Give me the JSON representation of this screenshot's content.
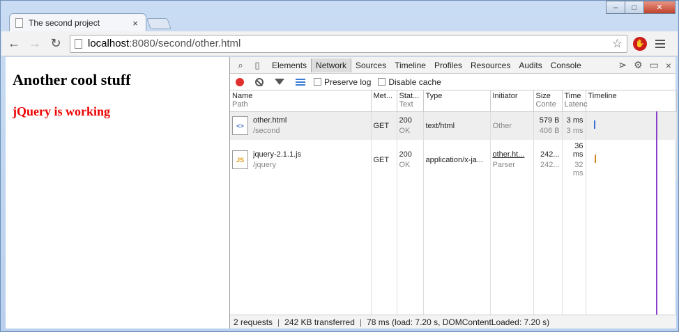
{
  "window": {
    "tab_title": "The second project",
    "tab_close": "×",
    "controls": {
      "minimize": "–",
      "maximize": "□",
      "close": "✕"
    }
  },
  "toolbar": {
    "url_host": "localhost",
    "url_path": ":8080/second/other.html",
    "back": "←",
    "forward": "→",
    "reload": "↻",
    "star": "☆"
  },
  "page": {
    "heading": "Another cool stuff",
    "status": "jQuery is working"
  },
  "devtools": {
    "tabs": [
      "Elements",
      "Network",
      "Sources",
      "Timeline",
      "Profiles",
      "Resources",
      "Audits",
      "Console"
    ],
    "active_tab": "Network",
    "checkboxes": {
      "preserve_log": "Preserve log",
      "disable_cache": "Disable cache"
    },
    "columns": {
      "name": "Name",
      "name_sub": "Path",
      "method": "Met...",
      "status": "Stat...",
      "status_sub": "Text",
      "type": "Type",
      "initiator": "Initiator",
      "size": "Size",
      "size_sub": "Conte",
      "time": "Time",
      "time_sub": "Latenc",
      "timeline": "Timeline"
    },
    "rows": [
      {
        "name": "other.html",
        "path": "/second",
        "method": "GET",
        "status": "200",
        "status_text": "OK",
        "type": "text/html",
        "initiator": "Other",
        "initiator_sub": "",
        "size": "579 B",
        "content": "406 B",
        "time": "3 ms",
        "latency": "3 ms",
        "icon": "html-file-icon",
        "bar_color": "#3a6fd8"
      },
      {
        "name": "jquery-2.1.1.js",
        "path": "/jquery",
        "method": "GET",
        "status": "200",
        "status_text": "OK",
        "type": "application/x-ja...",
        "initiator": "other.ht...",
        "initiator_sub": "Parser",
        "size": "242...",
        "content": "242...",
        "time": "36 ms",
        "latency": "32 ms",
        "icon": "js-file-icon",
        "bar_color": "#d08a2a"
      }
    ],
    "status_bar": {
      "requests": "2 requests",
      "transferred": "242 KB transferred",
      "timing": "78 ms (load: 7.20 s, DOMContentLoaded: 7.20 s)"
    }
  }
}
